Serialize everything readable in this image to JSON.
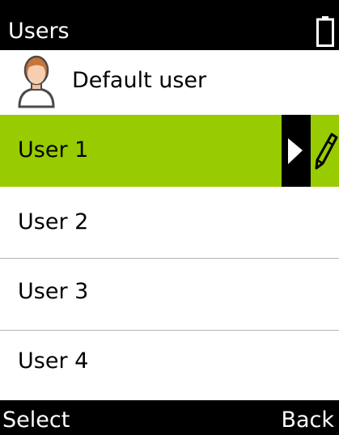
{
  "header": {
    "title": "Users",
    "battery_icon": "battery-icon"
  },
  "default_user": {
    "label": "Default user",
    "icon": "person-avatar-icon"
  },
  "users": [
    {
      "label": "User 1",
      "selected": true
    },
    {
      "label": "User 2",
      "selected": false
    },
    {
      "label": "User 3",
      "selected": false
    },
    {
      "label": "User 4",
      "selected": false
    }
  ],
  "selected_row_icons": [
    "play-arrow-icon",
    "pencil-edit-icon"
  ],
  "softkeys": {
    "left": "Select",
    "right": "Back"
  },
  "colors": {
    "selection": "#99cc00",
    "bars": "#000000",
    "background": "#ffffff"
  }
}
